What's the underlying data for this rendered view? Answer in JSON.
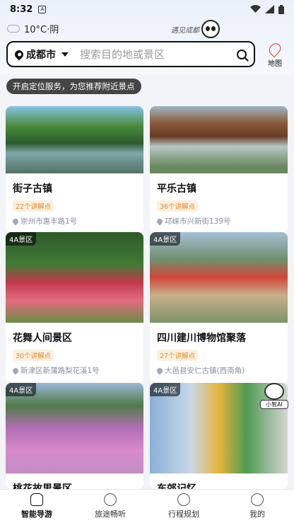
{
  "status_bar": {
    "time": "8:32"
  },
  "header": {
    "weather": "10°C·阴",
    "slogan": "遇见成都",
    "city": "成都市",
    "search_placeholder": "搜索目的地或景区",
    "map_label": "地图"
  },
  "tooltip": "开启定位服务，为您推荐附近景点",
  "cards": [
    {
      "title": "街子古镇",
      "tag": "",
      "badge": "22个讲解点",
      "address": "崇州市惠丰路1号"
    },
    {
      "title": "平乐古镇",
      "tag": "",
      "badge": "36个讲解点",
      "address": "邛崃市兴新街139号"
    },
    {
      "title": "花舞人间景区",
      "tag": "4A景区",
      "badge": "30个讲解点",
      "address": "新津区新蒲路梨花溪1号"
    },
    {
      "title": "四川建川博物馆聚落",
      "tag": "4A景区",
      "badge": "27个讲解点",
      "address": "大邑县安仁古镇(西南角)"
    },
    {
      "title": "桃花故里景区",
      "tag": "4A景区",
      "badge": "",
      "address": ""
    },
    {
      "title": "东郊记忆",
      "tag": "4A景区",
      "badge": "",
      "address": ""
    }
  ],
  "mascot_label": "小智AI",
  "bottom_nav": [
    {
      "label": "智能导游",
      "icon": "home-icon",
      "active": true
    },
    {
      "label": "旅途畅听",
      "icon": "music-icon",
      "active": false
    },
    {
      "label": "行程规划",
      "icon": "plus-circle-icon",
      "active": false
    },
    {
      "label": "我的",
      "icon": "user-icon",
      "active": false
    }
  ]
}
